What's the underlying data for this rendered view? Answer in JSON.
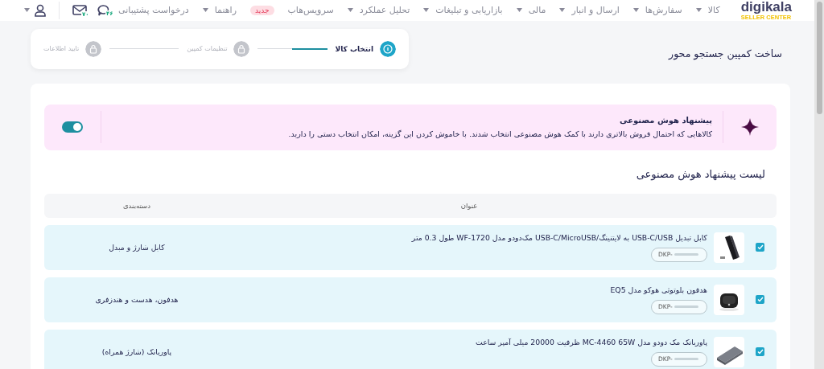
{
  "brand": {
    "name": "digikala",
    "subtitle": "SELLER CENTER"
  },
  "nav": [
    {
      "label": "کالا",
      "has_menu": true
    },
    {
      "label": "سفارش‌ها",
      "has_menu": true
    },
    {
      "label": "ارسال و انبار",
      "has_menu": true
    },
    {
      "label": "مالی",
      "has_menu": true
    },
    {
      "label": "بازاریابی و تبلیغات",
      "has_menu": true
    },
    {
      "label": "تحلیل عملکرد",
      "has_menu": true
    },
    {
      "label": "سرویس‌هاب",
      "has_menu": false,
      "badge": "جدید"
    },
    {
      "label": "راهنما",
      "has_menu": true
    },
    {
      "label": "درخواست پشتیبانی",
      "has_menu": false
    }
  ],
  "header_icons": [
    {
      "kind": "chat",
      "badge": "۴۶"
    },
    {
      "kind": "mail",
      "badge": "۷۰"
    },
    {
      "kind": "user",
      "has_menu": true
    }
  ],
  "page_title": "ساخت کمپین جستجو محور",
  "steps": [
    {
      "label": "انتخاب کالا",
      "selected": true
    },
    {
      "label": "تنظیمات کمپین",
      "selected": false
    },
    {
      "label": "تایید اطلاعات",
      "selected": false
    }
  ],
  "ai_banner": {
    "title": "پیشنهاد هوش مصنوعی",
    "text": "کالاهایی که احتمال فروش بالاتری دارند با کمک هوش مصنوعی انتخاب شدند. با خاموش کردن این گزینه، امکان انتخاب دستی را دارید.",
    "on": true
  },
  "list_title": "لیست پیشنهاد هوش مصنوعی",
  "table": {
    "columns": [
      "عنوان",
      "دسته‌بندی"
    ],
    "rows": [
      {
        "checked": true,
        "title": "کابل تبدیل USB-C/USB به لایتنینگ/USB-C/MicroUSB مک‌دودو مدل WF-1720 طول 0.3 متر",
        "code": "DKP-",
        "category": "کابل شارژ و مبدل"
      },
      {
        "checked": true,
        "title": "هدفون بلوتوثی هوکو مدل EQ5",
        "code": "DKP-",
        "category": "هدفون، هدست و هندزفری"
      },
      {
        "checked": true,
        "title": "پاوربانک مک دودو مدل MC-4460 65W ظرفیت 20000 میلی آمپر ساعت",
        "code": "DKP-",
        "category": "پاوربانک (شارژ همراه)"
      }
    ]
  }
}
